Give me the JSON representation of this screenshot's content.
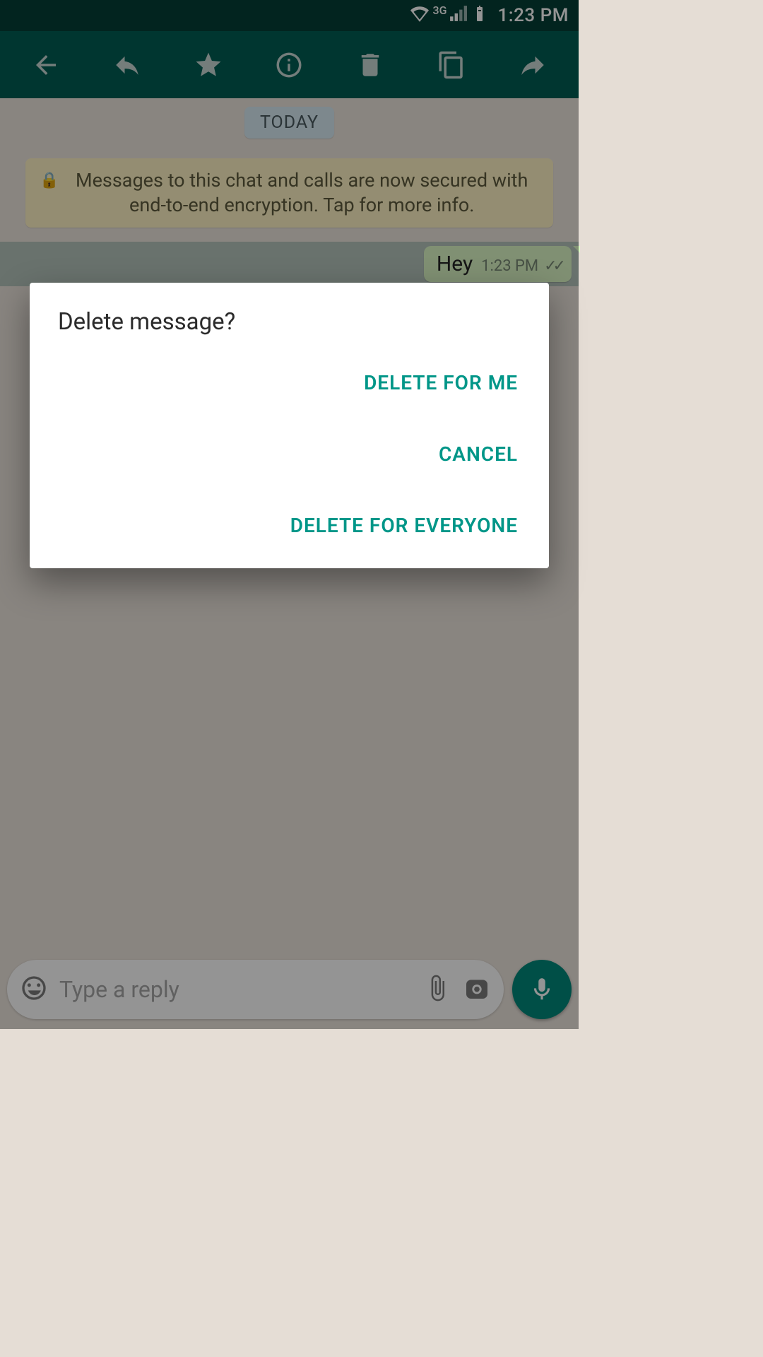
{
  "status": {
    "network": "3G",
    "time": "1:23 PM"
  },
  "chat": {
    "date_label": "TODAY",
    "encryption_notice": "Messages to this chat and calls are now secured with end-to-end encryption. Tap for more info.",
    "selected_message": {
      "text": "Hey",
      "time": "1:23 PM"
    },
    "input_placeholder": "Type a reply"
  },
  "dialog": {
    "title": "Delete message?",
    "actions": {
      "delete_me": "DELETE FOR ME",
      "cancel": "CANCEL",
      "delete_everyone": "DELETE FOR EVERYONE"
    }
  }
}
